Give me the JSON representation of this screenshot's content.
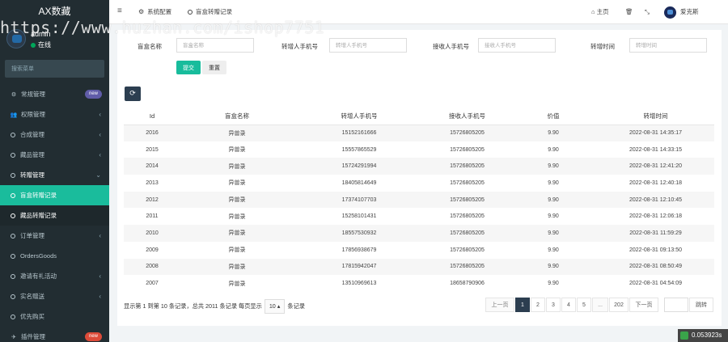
{
  "sidebar": {
    "brand": "AX数藏",
    "user": {
      "name": "admin",
      "status": "在线"
    },
    "search_placeholder": "搜索菜单",
    "items": [
      {
        "icon": "⚙",
        "label": "常规管理",
        "badge": "new"
      },
      {
        "icon": "👥",
        "label": "权限管理",
        "chevron": "‹"
      },
      {
        "label": "合成管理",
        "chevron": "‹"
      },
      {
        "label": "藏品管理",
        "chevron": "‹"
      },
      {
        "label": "转赠管理",
        "chevron": "⌄"
      },
      {
        "label": "盲盒转赠记录"
      },
      {
        "label": "藏品转赠记录"
      },
      {
        "label": "订单管理",
        "chevron": "‹"
      },
      {
        "label": "OrdersGoods"
      },
      {
        "label": "邀请有礼活动",
        "chevron": "‹"
      },
      {
        "label": "实名赠送",
        "chevron": "‹"
      },
      {
        "label": "优先购买"
      },
      {
        "icon": "✈",
        "label": "插件管理",
        "badge": "new"
      }
    ]
  },
  "topnav": {
    "menu_icon": "≡",
    "tabs": [
      {
        "icon": "⚙",
        "label": "系统配置"
      },
      {
        "label": "盲盒转赠记录"
      }
    ],
    "home": "主页",
    "home_icon": "⌂",
    "fullscreen_icon": "⤡",
    "username": "爱克斯"
  },
  "filters": {
    "name": {
      "label": "盲盒名称",
      "placeholder": "盲盒名称"
    },
    "from_phone": {
      "label": "转增人手机号",
      "placeholder": "转增人手机号"
    },
    "to_phone": {
      "label": "接收人手机号",
      "placeholder": "接收人手机号"
    },
    "time": {
      "label": "转增时间",
      "placeholder": "转增时间"
    },
    "submit": "提交",
    "reset": "重置",
    "refresh_icon": "⟳"
  },
  "table": {
    "columns": [
      "Id",
      "盲盒名称",
      "转增人手机号",
      "接收人手机号",
      "价值",
      "转增时间"
    ],
    "rows": [
      [
        "2016",
        "异兽录",
        "15152161666",
        "15726805205",
        "9.90",
        "2022-08-31 14:35:17"
      ],
      [
        "2015",
        "异兽录",
        "15557865529",
        "15726805205",
        "9.90",
        "2022-08-31 14:33:15"
      ],
      [
        "2014",
        "异兽录",
        "15724291994",
        "15726805205",
        "9.90",
        "2022-08-31 12:41:20"
      ],
      [
        "2013",
        "异兽录",
        "18405814649",
        "15726805205",
        "9.90",
        "2022-08-31 12:40:18"
      ],
      [
        "2012",
        "异兽录",
        "17374107703",
        "15726805205",
        "9.90",
        "2022-08-31 12:10:45"
      ],
      [
        "2011",
        "异兽录",
        "15258101431",
        "15726805205",
        "9.90",
        "2022-08-31 12:06:18"
      ],
      [
        "2010",
        "异兽录",
        "18557530932",
        "15726805205",
        "9.90",
        "2022-08-31 11:59:29"
      ],
      [
        "2009",
        "异兽录",
        "17856938679",
        "15726805205",
        "9.90",
        "2022-08-31 09:13:50"
      ],
      [
        "2008",
        "异兽录",
        "17815942047",
        "15726805205",
        "9.90",
        "2022-08-31 08:50:49"
      ],
      [
        "2007",
        "异兽录",
        "13510969613",
        "18658790906",
        "9.90",
        "2022-08-31 04:54:09"
      ]
    ]
  },
  "pagination": {
    "info_prefix": "显示第 1 到第 10 条记录，总共 2011 条记录 每页显示",
    "page_size": "10 ▴",
    "info_suffix": "条记录",
    "prev": "上一页",
    "pages": [
      "1",
      "2",
      "3",
      "4",
      "5"
    ],
    "ellipsis": "...",
    "last_page": "202",
    "next": "下一页",
    "jump": "跳转"
  },
  "watermark": "https://www.huzhan.com/ishop7751",
  "timer": "0.053923s"
}
